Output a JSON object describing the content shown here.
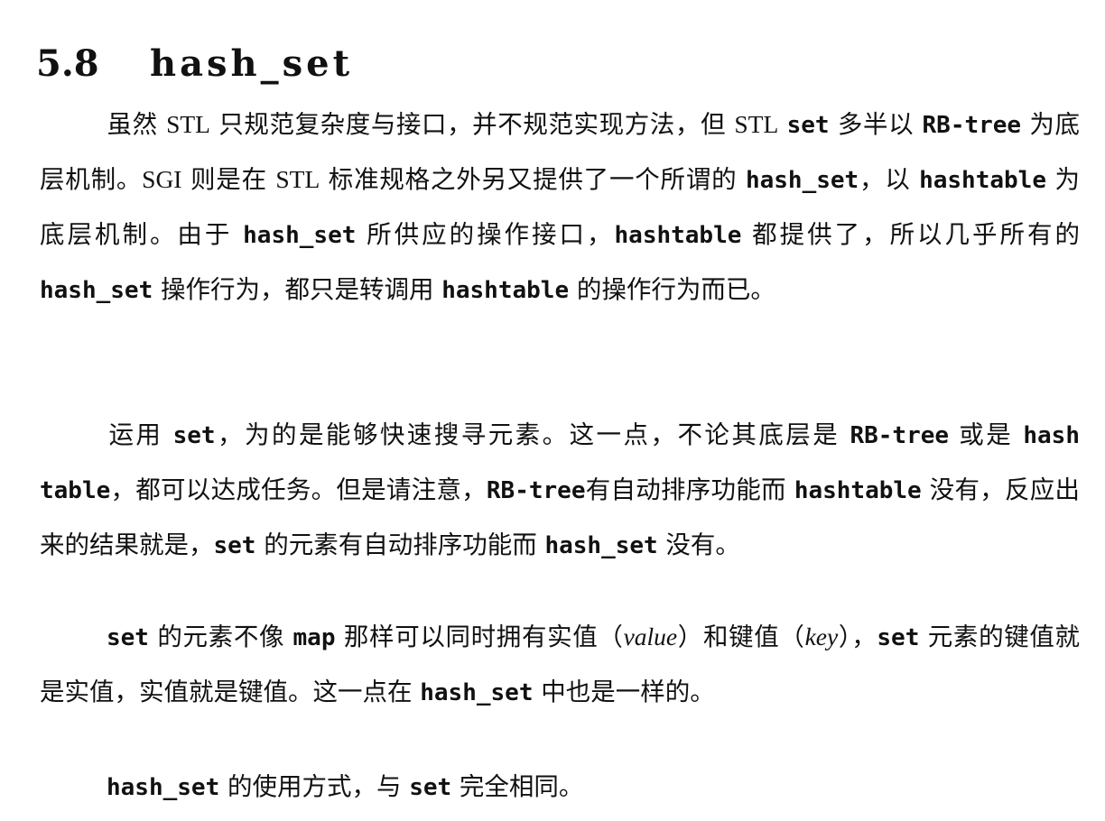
{
  "section": {
    "number": "5.8",
    "title": "hash_set"
  },
  "paragraphs": {
    "p1": {
      "s1": "虽然 ",
      "s2": "STL",
      "s3": " 只规范复杂度与接口，并不规范实现方法，但 ",
      "s4": "STL",
      "s5": " ",
      "s6": "set",
      "s7": " 多半以 ",
      "s8": "RB-tree",
      "s9": " 为底层机制。",
      "s10": "SGI",
      "s11": " 则是在 ",
      "s12": "STL",
      "s13": " 标准规格之外另又提供了一个所谓的 ",
      "s14": "hash_set",
      "s15": "，以 ",
      "s16": "hashtable",
      "s17": " 为底层机制。由于 ",
      "s18": "hash_set",
      "s19": " 所供应的操作接口，",
      "s20": "hashtable",
      "s21": " 都提供了，所以几乎所有的 ",
      "s22": "hash_set",
      "s23": " 操作行为，都只是转调用 ",
      "s24": "hashtable",
      "s25": " 的操作行为而已。"
    },
    "p2": {
      "s1": "运用 ",
      "s2": "set",
      "s3": "，为的是能够快速搜寻元素。这一点，不论其底层是 ",
      "s4": "RB-tree",
      "s5": " 或是 ",
      "s6": "hash table",
      "s7": "，都可以达成任务。但是请注意，",
      "s8": "RB-tree",
      "s9": "有自动排序功能而 ",
      "s10": "hashtable",
      "s11": " 没有，反应出来的结果就是，",
      "s12": "set",
      "s13": " 的元素有自动排序功能而 ",
      "s14": "hash_set",
      "s15": " 没有。"
    },
    "p3": {
      "s1": "set",
      "s2": " 的元素不像 ",
      "s3": "map",
      "s4": " 那样可以同时拥有实值（",
      "s5": "value",
      "s6": "）和键值（",
      "s7": "key",
      "s8": "），",
      "s9": "set",
      "s10": " 元素的键值就是实值，实值就是键值。这一点在 ",
      "s11": "hash_set",
      "s12": " 中也是一样的。"
    },
    "p4": {
      "s1": "hash_set",
      "s2": " 的使用方式，与 ",
      "s3": "set",
      "s4": " 完全相同。"
    }
  }
}
